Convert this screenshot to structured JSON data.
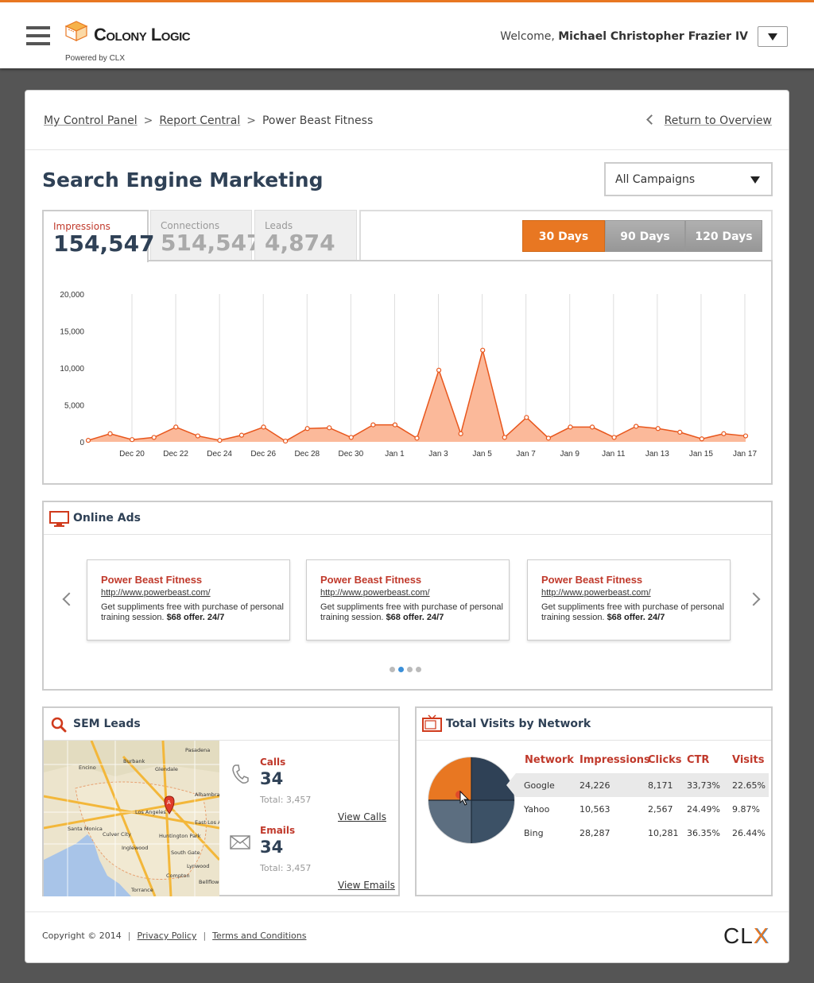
{
  "header": {
    "brand": "Colony Logic",
    "powered_by": "Powered by CLX",
    "welcome_prefix": "Welcome,",
    "user_name": "Michael Christopher Frazier IV",
    "accent": "#e87722"
  },
  "breadcrumb": {
    "items": [
      "My Control Panel",
      "Report Central",
      "Power Beast Fitness"
    ],
    "separator": ">",
    "return_label": "Return to Overview"
  },
  "page": {
    "title": "Search Engine Marketing",
    "campaign_select": "All Campaigns"
  },
  "tabs": [
    {
      "label": "Impressions",
      "value": "154,547"
    },
    {
      "label": "Connections",
      "value": "514,547"
    },
    {
      "label": "Leads",
      "value": "4,874"
    }
  ],
  "ranges": [
    "30 Days",
    "90 Days",
    "120 Days"
  ],
  "chart_data": {
    "type": "area",
    "ylim": [
      0,
      20000
    ],
    "y_ticks": [
      "20,000",
      "15,000",
      "10,000",
      "5,000",
      "0"
    ],
    "x_ticks": [
      "Dec 20",
      "Dec 22",
      "Dec 24",
      "Dec 26",
      "Dec 28",
      "Dec 30",
      "Jan 1",
      "Jan 3",
      "Jan 5",
      "Jan 7",
      "Jan 9",
      "Jan 11",
      "Jan 13",
      "Jan 15",
      "Jan 17"
    ],
    "x": [
      "Dec 19",
      "Dec 19",
      "Dec 20",
      "Dec 21",
      "Dec 22",
      "Dec 23",
      "Dec 24",
      "Dec 25",
      "Dec 26",
      "Dec 27",
      "Dec 28",
      "Dec 29",
      "Dec 30",
      "Dec 31",
      "Jan 1",
      "Jan 2",
      "Jan 3",
      "Jan 4",
      "Jan 5",
      "Jan 6",
      "Jan 7",
      "Jan 8",
      "Jan 9",
      "Jan 10",
      "Jan 11",
      "Jan 12",
      "Jan 13",
      "Jan 14",
      "Jan 15",
      "Jan 16",
      "Jan 17"
    ],
    "values": [
      200,
      1100,
      300,
      600,
      2000,
      800,
      200,
      900,
      2000,
      100,
      1800,
      1900,
      600,
      2300,
      2300,
      500,
      9700,
      1100,
      12400,
      600,
      3300,
      500,
      2000,
      2000,
      600,
      2100,
      1800,
      1300,
      400,
      1100,
      800
    ],
    "grid": true,
    "color": "#e8561c"
  },
  "ads": {
    "title": "Online Ads",
    "items": [
      {
        "headline": "Power Beast Fitness",
        "url": "http://www.powerbeast.com/",
        "text": "Get suppliments free with purchase of personal training session.",
        "offer": "$68 offer. 24/7"
      },
      {
        "headline": "Power Beast Fitness",
        "url": "http://www.powerbeast.com/",
        "text": "Get suppliments free with purchase of personal training session.",
        "offer": "$68 offer. 24/7"
      },
      {
        "headline": "Power Beast Fitness",
        "url": "http://www.powerbeast.com/",
        "text": "Get suppliments free with purchase of personal training session.",
        "offer": "$68 offer. 24/7"
      }
    ],
    "page_count": 4,
    "active_page": 2
  },
  "leads": {
    "title": "SEM Leads",
    "calls": {
      "label": "Calls",
      "value": "34",
      "total": "Total: 3,457",
      "link": "View Calls"
    },
    "emails": {
      "label": "Emails",
      "value": "34",
      "total": "Total: 3,457",
      "link": "View Emails"
    },
    "map_labels": [
      "Pasadena",
      "Glendale",
      "Burbank",
      "Los Angeles",
      "Santa Monica",
      "Culver City",
      "Inglewood",
      "Huntington Park",
      "East Los Angeles",
      "South Gate",
      "Compton",
      "Torrance",
      "Lynwood",
      "Bellflower",
      "Encino",
      "Alhambra"
    ]
  },
  "network": {
    "title": "Total Visits by Network",
    "columns": [
      "Network",
      "Impressions",
      "Clicks",
      "CTR",
      "Visits"
    ],
    "rows": [
      [
        "Google",
        "24,226",
        "8,171",
        "33,73%",
        "22.65%"
      ],
      [
        "Yahoo",
        "10,563",
        "2,567",
        "24.49%",
        "9.87%"
      ],
      [
        "Bing",
        "28,287",
        "10,281",
        "36.35%",
        "26.44%"
      ]
    ],
    "pie_colors": [
      "#e87722",
      "#2f4156",
      "#5c6e80",
      "#3c5166"
    ]
  },
  "footer": {
    "copyright": "Copyright © 2014",
    "privacy": "Privacy Policy",
    "terms": "Terms and Conditions",
    "logo": "CLX"
  }
}
